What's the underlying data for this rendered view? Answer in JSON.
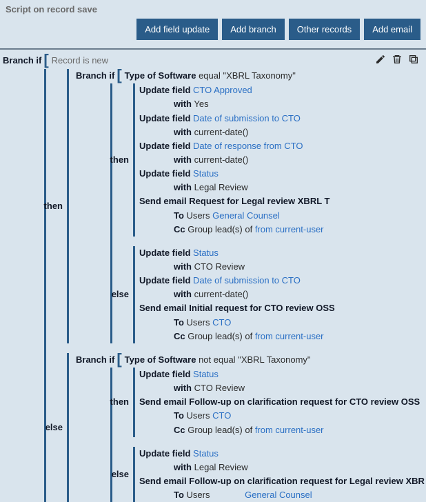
{
  "header": {
    "title": "Script on record save",
    "buttons": {
      "addFieldUpdate": "Add field update",
      "addBranch": "Add branch",
      "otherRecords": "Other records",
      "addEmail": "Add email"
    }
  },
  "labels": {
    "branchIf": "Branch if",
    "then": "then",
    "else": "else",
    "updateField": "Update field",
    "with": "with",
    "sendEmail": "Send email",
    "to": "To",
    "cc": "Cc",
    "users": "Users",
    "groupLeadsOf": "Group lead(s) of",
    "equal": "equal",
    "notEqual": "not equal"
  },
  "root": {
    "condition": "Record is new"
  },
  "thenBranch": {
    "field": "Type of Software",
    "value": "\"XBRL Taxonomy\"",
    "then": {
      "updates": [
        {
          "field": "CTO Approved",
          "with": "Yes",
          "fieldLink": true
        },
        {
          "field": "Date of submission to CTO",
          "with": "current-date()",
          "fieldLink": true
        },
        {
          "field": "Date of response from CTO",
          "with": "current-date()",
          "fieldLink": true
        },
        {
          "field": "Status",
          "with": "Legal Review",
          "fieldLink": true
        }
      ],
      "email": {
        "name": "Request for Legal review XBRL T",
        "toUsers": "General Counsel",
        "ccTail": "from current-user"
      }
    },
    "else": {
      "updates": [
        {
          "field": "Status",
          "with": "CTO Review",
          "fieldLink": true
        },
        {
          "field": "Date of submission to CTO",
          "with": "current-date()",
          "fieldLink": true
        }
      ],
      "email": {
        "name": "Initial request for CTO review OSS",
        "toUsers": "CTO",
        "ccTail": "from current-user"
      }
    }
  },
  "elseBranch": {
    "field": "Type of Software",
    "value": "\"XBRL Taxonomy\"",
    "then": {
      "updates": [
        {
          "field": "Status",
          "with": "CTO Review",
          "fieldLink": true
        }
      ],
      "email": {
        "name": "Follow-up on clarification request for CTO review OSS",
        "toUsers": "CTO",
        "ccTail": "from current-user"
      }
    },
    "else": {
      "updates": [
        {
          "field": "Status",
          "with": "Legal Review",
          "fieldLink": true
        }
      ],
      "email": {
        "name": "Follow-up on clarification request for Legal review XBR",
        "toUsers": "General Counsel"
      }
    }
  }
}
